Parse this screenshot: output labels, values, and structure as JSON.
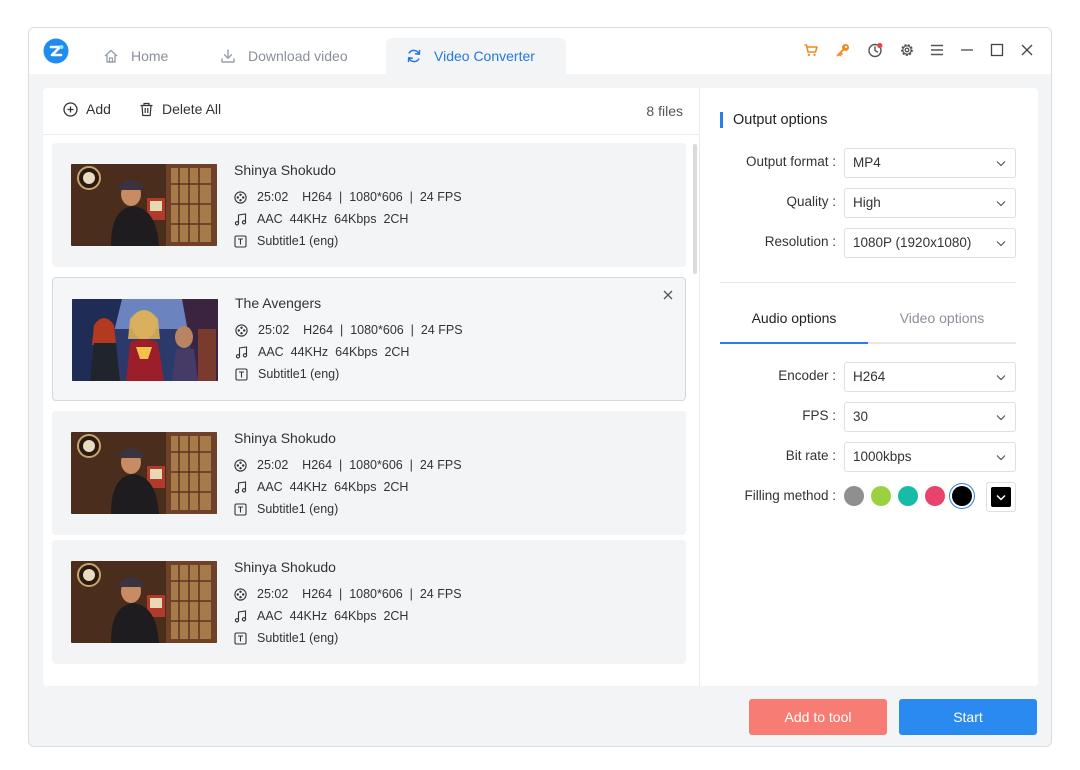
{
  "tabs": {
    "home": "Home",
    "download": "Download video",
    "converter": "Video Converter"
  },
  "title_icons": [
    "cart-icon",
    "key-icon",
    "clock-icon",
    "gear-icon",
    "menu-icon",
    "minimize-icon",
    "maximize-icon",
    "close-icon"
  ],
  "toolbar": {
    "add": "Add",
    "delete_all": "Delete All",
    "file_count": "8 files"
  },
  "files": [
    {
      "title": "Shinya Shokudo",
      "video": "25:02    H264  |  1080*606  |  24 FPS",
      "audio": "AAC  44KHz  64Kbps  2CH",
      "subtitle": "Subtitle1 (eng)"
    },
    {
      "title": "The Avengers",
      "video": "25:02    H264  |  1080*606  |  24 FPS",
      "audio": "AAC  44KHz  64Kbps  2CH",
      "subtitle": "Subtitle1 (eng)"
    },
    {
      "title": "Shinya Shokudo",
      "video": "25:02    H264  |  1080*606  |  24 FPS",
      "audio": "AAC  44KHz  64Kbps  2CH",
      "subtitle": "Subtitle1 (eng)"
    },
    {
      "title": "Shinya Shokudo",
      "video": "25:02    H264  |  1080*606  |  24 FPS",
      "audio": "AAC  44KHz  64Kbps  2CH",
      "subtitle": "Subtitle1 (eng)"
    }
  ],
  "output": {
    "title": "Output options",
    "format_label": "Output format :",
    "format_value": "MP4",
    "quality_label": "Quality :",
    "quality_value": "High",
    "resolution_label": "Resolution :",
    "resolution_value": "1080P (1920x1080)"
  },
  "subtabs": {
    "audio": "Audio options",
    "video": "Video options"
  },
  "encoding": {
    "encoder_label": "Encoder :",
    "encoder_value": "H264",
    "fps_label": "FPS :",
    "fps_value": "30",
    "bitrate_label": "Bit rate :",
    "bitrate_value": "1000kbps",
    "filling_label": "Filling method :"
  },
  "fill_colors": [
    "#8f8f8f",
    "#9bd13c",
    "#18bba8",
    "#e8436b",
    "#000000"
  ],
  "selected_fill_color": "#000000",
  "colors": {
    "accent": "#2b7de9",
    "add_button": "#f77c73",
    "start_button": "#2b8af0"
  },
  "buttons": {
    "add_to_tool": "Add to tool",
    "start": "Start"
  }
}
